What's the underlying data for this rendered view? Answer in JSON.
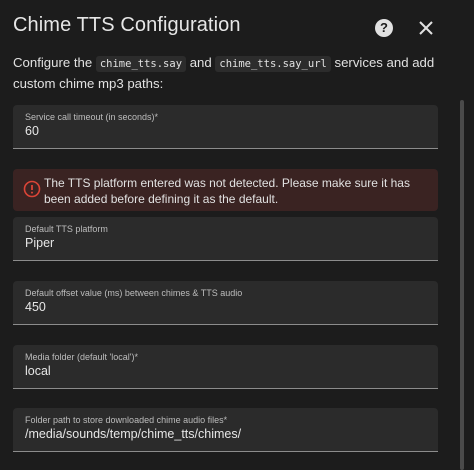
{
  "dialog": {
    "title": "Chime TTS Configuration",
    "help_icon": "help-circle-icon",
    "close_icon": "close-icon",
    "intro": {
      "prefix": "Configure the ",
      "code1": "chime_tts.say",
      "middle": " and ",
      "code2": "chime_tts.say_url",
      "suffix": " services and add custom chime mp3 paths:"
    }
  },
  "fields": {
    "timeout": {
      "label": "Service call timeout (in seconds)*",
      "value": "60"
    },
    "platform": {
      "label": "Default TTS platform",
      "value": "Piper"
    },
    "offset": {
      "label": "Default offset value (ms) between chimes & TTS audio",
      "value": "450"
    },
    "media_folder": {
      "label": "Media folder (default 'local')*",
      "value": "local"
    },
    "folder_path": {
      "label": "Folder path to store downloaded chime audio files*",
      "value": "/media/sounds/temp/chime_tts/chimes/"
    }
  },
  "error": {
    "icon": "alert-circle-icon",
    "message": "The TTS platform entered was not detected. Please make sure it has been added before defining it as the default.",
    "color": "#db4437"
  }
}
